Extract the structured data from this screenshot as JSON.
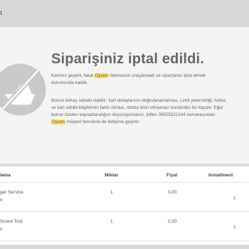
{
  "header": {
    "mark": "ı"
  },
  "banner": {
    "icon": "cancelled-cart-icon",
    "title": "Siparişiniz iptal edildi.",
    "message1": {
      "part1": "Kartınız geçerli, fakat ",
      "highlight": "Dyson",
      "part2": " ödemenizi onaylamadı ve siparişinizi iptal etmek durumunda kaldık."
    },
    "message2": {
      "part1": "Bunun birkaç sebebi olabilir; kart detaylarının doğrulanamaması, Limit yetersizliği, Adres ve kart sahibi bilgilerinin farklı olması, stokta ürün olmaması bunlardan bir kaçıdır. Eğer bunun bizden kaynaklandığını düşünüyorsanız, lütfen 08505321144 numarasından ",
      "highlight": "Dyson",
      "part2": " müşteri temsilcisi ile iletişime geçiniz."
    }
  },
  "table": {
    "headers": {
      "product": "lama",
      "qty": "Miktar",
      "price": "Fiyat",
      "installment": "Installment"
    },
    "rows": [
      {
        "name_line1": "ger Service",
        "name_line2": "lr",
        "qty": "1",
        "price": "0,00",
        "installment": "1"
      },
      {
        "name_line1": "Screw Tool",
        "name_line2": "il",
        "qty": "1",
        "price": "0,00",
        "installment": "1"
      }
    ]
  },
  "colors": {
    "highlight": "#ffe066",
    "icon_circle": "#c9c9c9",
    "background": "#f4f4f4",
    "bar": "#d8d8d8"
  }
}
